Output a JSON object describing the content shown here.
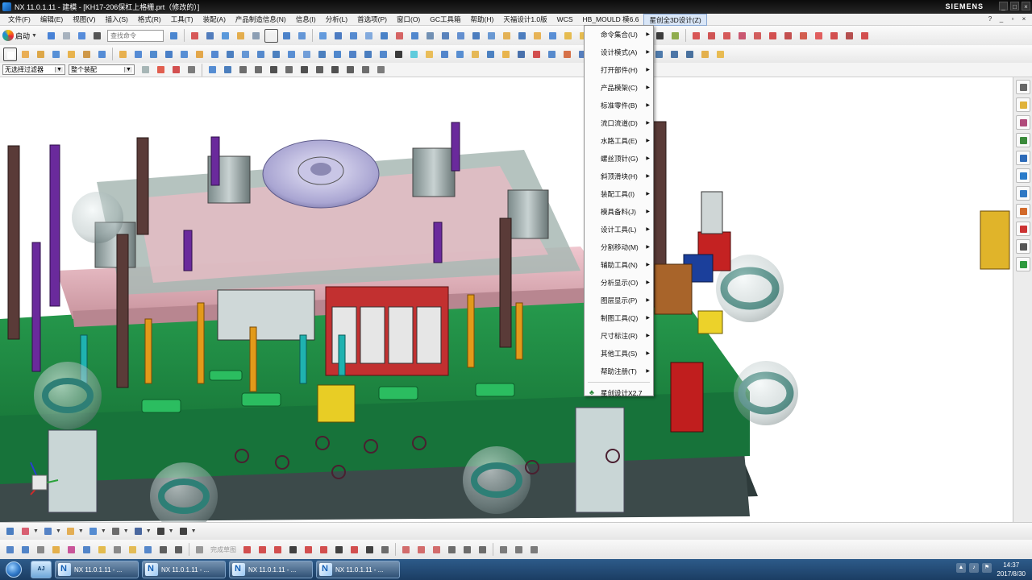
{
  "window": {
    "title": "NX 11.0.1.11 - 建模 - [KH17-206保杠上格栅.prt（修改的）]",
    "brand": "SIEMENS",
    "controls": [
      "_",
      "□",
      "×"
    ]
  },
  "menubar": {
    "items": [
      "文件(F)",
      "编辑(E)",
      "视图(V)",
      "插入(S)",
      "格式(R)",
      "工具(T)",
      "装配(A)",
      "产品制造信息(N)",
      "信息(I)",
      "分析(L)",
      "首选项(P)",
      "窗口(O)",
      "GC工具箱",
      "帮助(H)",
      "天福设计1.0版",
      "WCS",
      "HB_MOULD 模6.6",
      "星创全3D设计(Z)"
    ],
    "active_index": 17,
    "right_icons": [
      "?",
      "_",
      "▫",
      "×"
    ]
  },
  "toolbar1": {
    "start_label": "启动",
    "search_placeholder": "查找命令"
  },
  "toolbar3": {
    "filter_value": "无选择过滤器",
    "assembly_value": "整个装配"
  },
  "dropdown": {
    "items": [
      "命令集合(U)",
      "设计模式(A)",
      "打开部件(H)",
      "产品模架(C)",
      "标准零件(B)",
      "流口流道(D)",
      "水路工具(E)",
      "螺丝顶针(G)",
      "斜顶滑块(H)",
      "装配工具(I)",
      "模具备料(J)",
      "设计工具(L)",
      "分割移动(M)",
      "辅助工具(N)",
      "分析显示(O)",
      "图层显示(P)",
      "制图工具(Q)",
      "尺寸标注(R)",
      "其他工具(S)",
      "帮助注册(T)"
    ],
    "footer_label": "星创设计X2.7",
    "submenu_arrow": "▶"
  },
  "bottombar2": {
    "sketch_label": "完成草图"
  },
  "taskbar": {
    "pinned_label": "AJ",
    "tasks": [
      "NX 11.0.1.11 - ...",
      "NX 11.0.1.11 - ...",
      "NX 11.0.1.11 - ...",
      "NX 11.0.1.11 - ..."
    ],
    "time": "14:37",
    "date": "2017/8/30"
  },
  "colors": {
    "titlebar": "#111111",
    "menu_active": "#d9e6f7",
    "taskbar": "#1f4470",
    "plate_green": "#1f8f4a",
    "plate_pink": "#d9a9b3",
    "plate_dark": "#2f3f3f"
  },
  "icons": {
    "start": "nx-start-logo",
    "search": "search-icon",
    "resource_bar": [
      "settings-icon",
      "assembly-navigator-icon",
      "constraint-navigator-icon",
      "part-navigator-icon",
      "reuse-library-icon",
      "history-icon",
      "web-browser-icon",
      "palette-icon",
      "roles-icon"
    ]
  }
}
